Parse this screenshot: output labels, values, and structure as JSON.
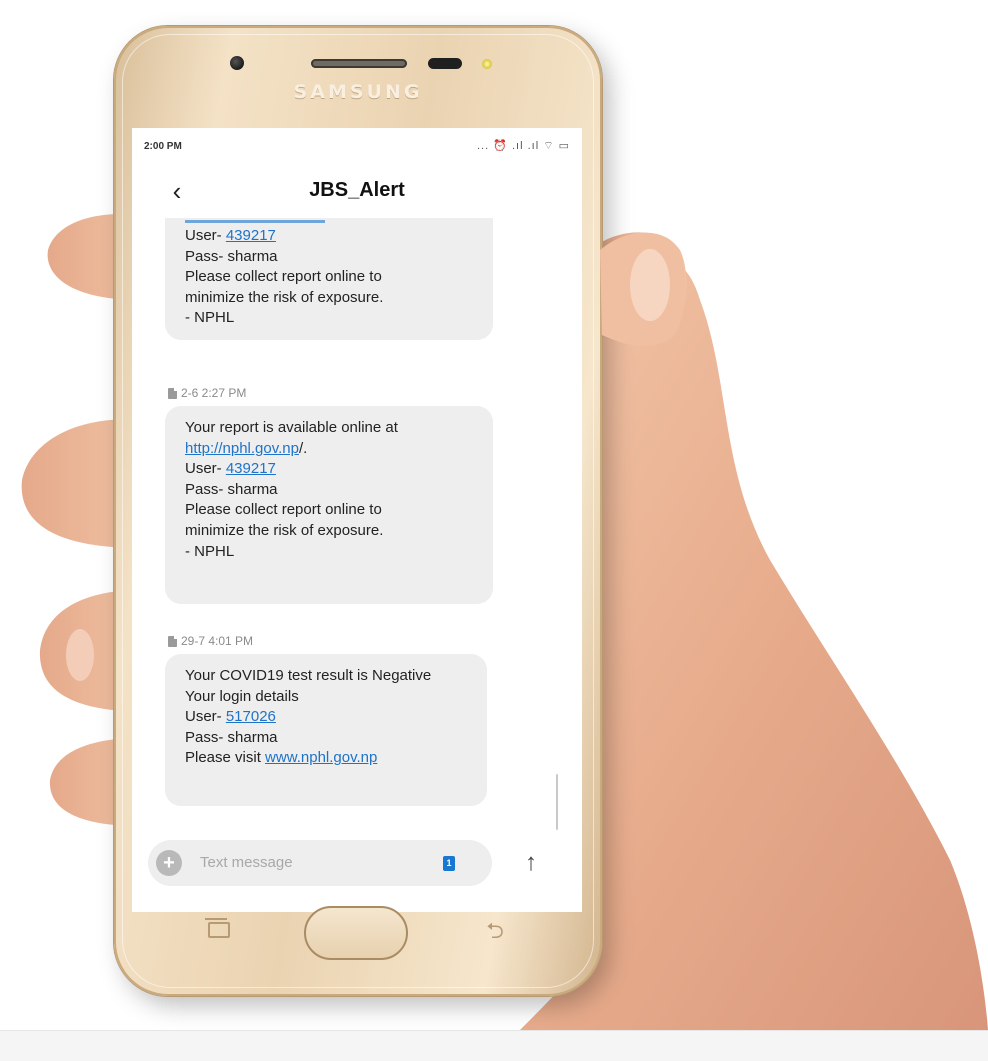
{
  "status_bar": {
    "time": "2:00 PM",
    "icons": "... ⏰ .ıl .ıl ⌔ ▭"
  },
  "header": {
    "back_icon": "chevron-left-icon",
    "title": "JBS_Alert"
  },
  "phone": {
    "brand": "SAMSUNG"
  },
  "messages": [
    {
      "lines": [
        {
          "prefix": "User- ",
          "link": "439217"
        },
        {
          "text": "Pass- sharma"
        },
        {
          "text": "Please collect report online to"
        },
        {
          "text": "minimize the risk of exposure."
        },
        {
          "text": "- NPHL"
        }
      ]
    },
    {
      "meta": "2-6 2:27 PM",
      "lines": [
        {
          "text": "Your report is available online at"
        },
        {
          "link": "http://nphl.gov.np",
          "suffix": "/."
        },
        {
          "prefix": "User- ",
          "link": "439217"
        },
        {
          "text": "Pass- sharma"
        },
        {
          "text": "Please collect report online to"
        },
        {
          "text": "minimize the risk of exposure."
        },
        {
          "text": "- NPHL"
        }
      ]
    },
    {
      "meta": "29-7 4:01 PM",
      "lines": [
        {
          "text": "Your COVID19 test result is Negative"
        },
        {
          "text": "Your login details"
        },
        {
          "prefix": "User- ",
          "link": "517026"
        },
        {
          "text": "Pass- sharma"
        },
        {
          "prefix": "Please visit ",
          "link": "www.nphl.gov.np"
        }
      ]
    }
  ],
  "compose": {
    "add_icon": "plus-circle-icon",
    "placeholder": "Text message",
    "sim_label": "1",
    "send_icon": "arrow-up-icon"
  },
  "colors": {
    "phone_gold": "#ead3b1",
    "bubble": "#eeeeee",
    "link": "#1e73c9",
    "sim_blue": "#1877d2",
    "skin": "#e8b395"
  }
}
